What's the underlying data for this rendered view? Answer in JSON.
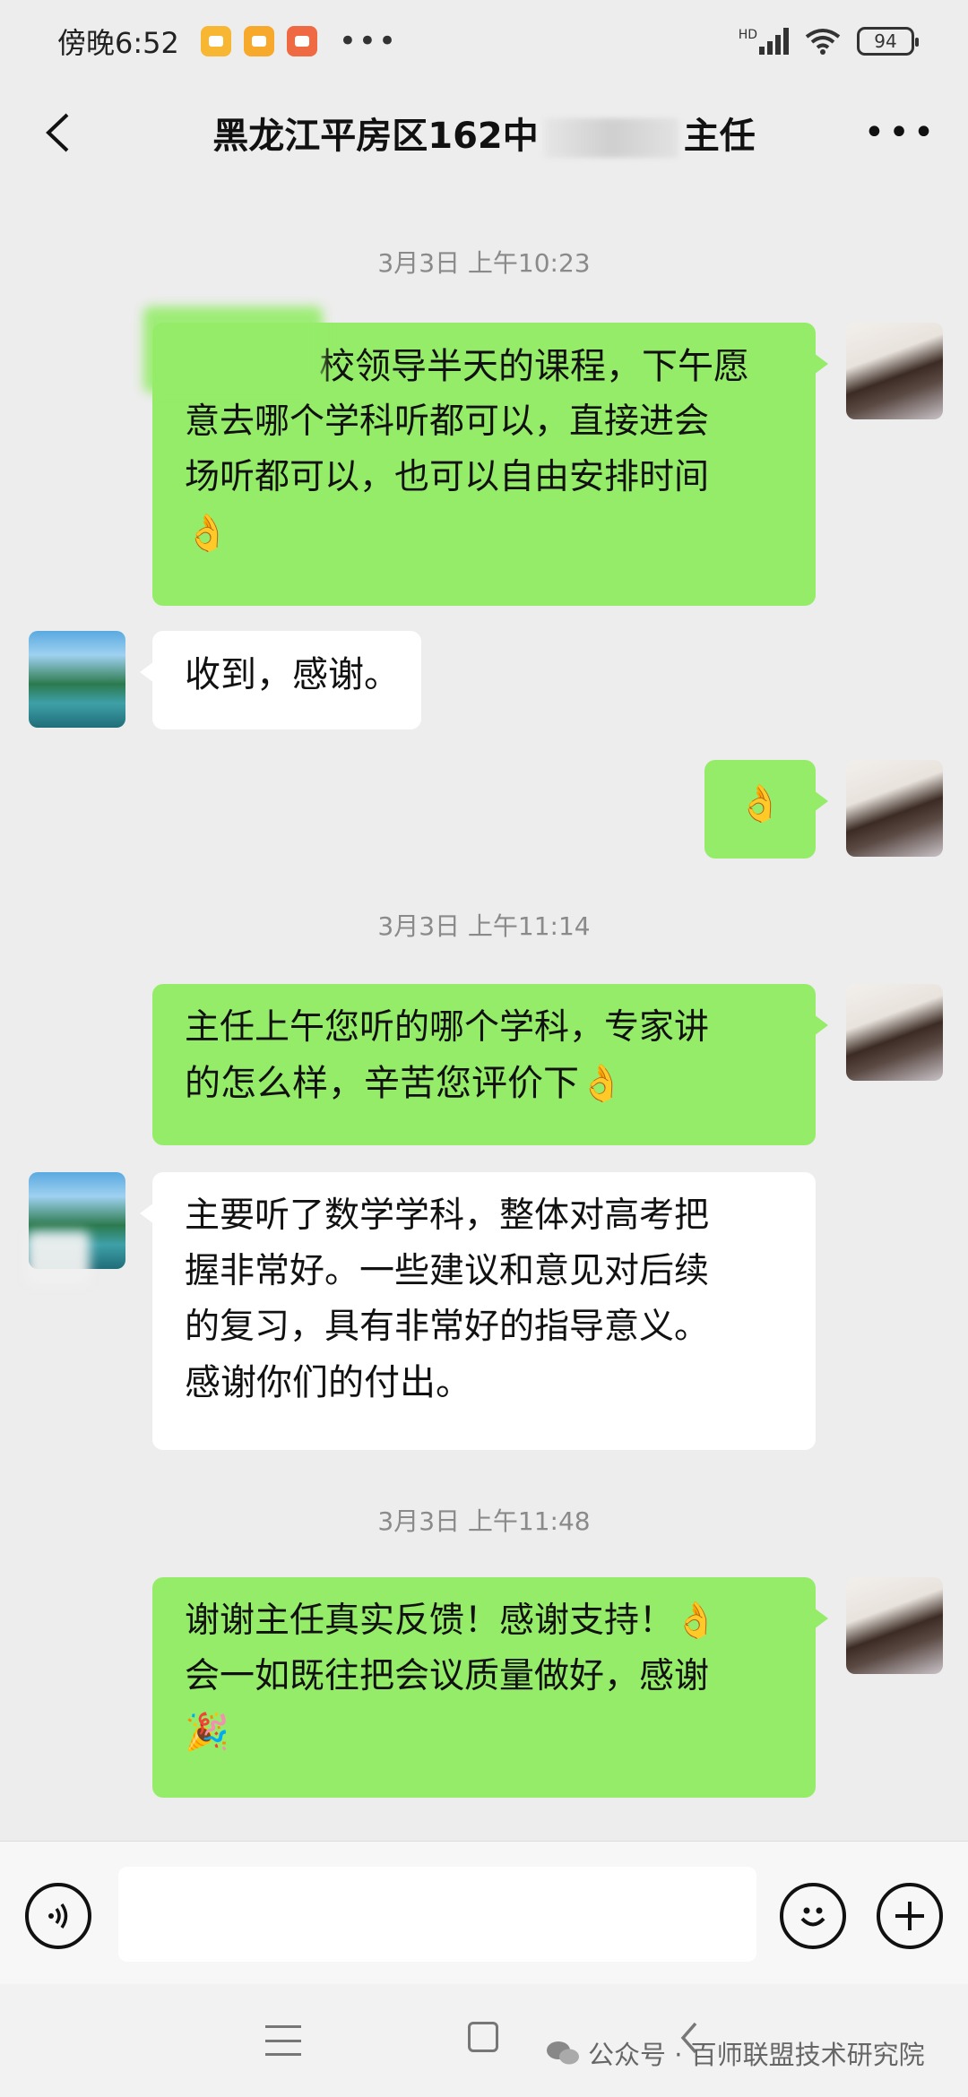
{
  "status_bar": {
    "time": "傍晚6:52",
    "dots": "•••",
    "network": "HD",
    "battery": "94"
  },
  "header": {
    "title_prefix": "黑龙江平房区162中",
    "title_suffix": "主任"
  },
  "messages": [
    {
      "type": "timestamp",
      "text": "3月3日 上午10:23"
    },
    {
      "type": "message",
      "sender": "me",
      "lines": [
        "校领导半天的课程，下午愿",
        "意去哪个学科听都可以，直接进会",
        "场听都可以，也可以自由安排时间",
        "👌"
      ]
    },
    {
      "type": "message",
      "sender": "other",
      "lines": [
        "收到，感谢。"
      ]
    },
    {
      "type": "message",
      "sender": "me",
      "lines": [
        "👌"
      ]
    },
    {
      "type": "timestamp",
      "text": "3月3日 上午11:14"
    },
    {
      "type": "message",
      "sender": "me",
      "lines": [
        "主任上午您听的哪个学科，专家讲",
        "的怎么样，辛苦您评价下👌"
      ]
    },
    {
      "type": "message",
      "sender": "other",
      "lines": [
        "主要听了数学学科，整体对高考把",
        "握非常好。一些建议和意见对后续",
        "的复习，具有非常好的指导意义。",
        "感谢你们的付出。"
      ]
    },
    {
      "type": "timestamp",
      "text": "3月3日 上午11:48"
    },
    {
      "type": "message",
      "sender": "me",
      "lines": [
        "谢谢主任真实反馈！感谢支持！👌",
        "会一如既往把会议质量做好，感谢",
        "🎉"
      ]
    }
  ],
  "watermark": "公众号 · 百师联盟技术研究院"
}
